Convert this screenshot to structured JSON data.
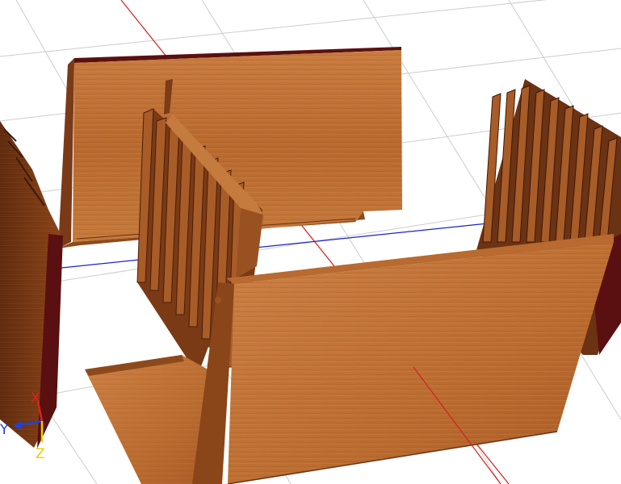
{
  "viewport": {
    "background": "#ffffff",
    "grid_color": "#c8c8c8",
    "axis_x_color": "#d42020",
    "axis_y_color": "#1a22c8",
    "wood_light": "#c77a3e",
    "wood_mid": "#a45a26",
    "wood_dark": "#6b3214",
    "wood_edge": "#5a0f0f"
  },
  "axis_triad": {
    "x_label": "X",
    "y_label": "Y",
    "z_label": "Z",
    "x_color": "#e02020",
    "y_color": "#2040e0",
    "z_color": "#e6d000"
  }
}
